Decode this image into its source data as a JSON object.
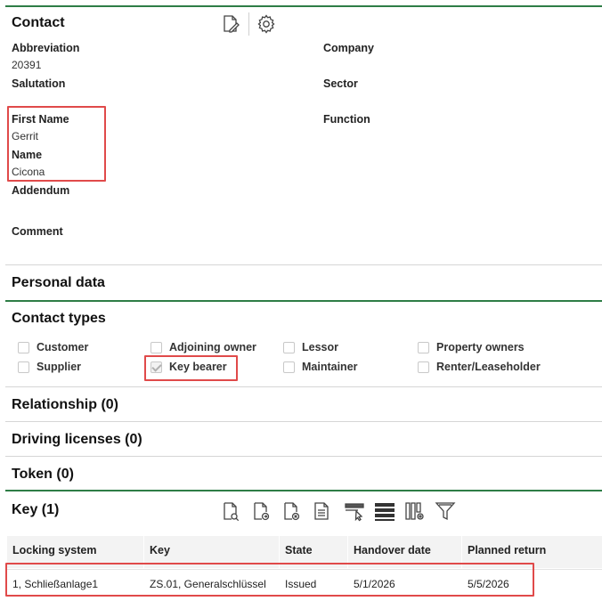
{
  "contact": {
    "title": "Contact",
    "fields": {
      "abbreviation_label": "Abbreviation",
      "abbreviation_value": "20391",
      "salutation_label": "Salutation",
      "first_name_label": "First Name",
      "first_name_value": "Gerrit",
      "name_label": "Name",
      "name_value": "Cicona",
      "addendum_label": "Addendum",
      "comment_label": "Comment",
      "company_label": "Company",
      "sector_label": "Sector",
      "function_label": "Function"
    },
    "icons": [
      "edit-document-icon",
      "gear-icon"
    ]
  },
  "personal_data": {
    "title": "Personal data"
  },
  "contact_types": {
    "title": "Contact types",
    "options": [
      {
        "label": "Customer",
        "checked": false
      },
      {
        "label": "Adjoining owner",
        "checked": false
      },
      {
        "label": "Lessor",
        "checked": false
      },
      {
        "label": "Property owners",
        "checked": false
      },
      {
        "label": "Supplier",
        "checked": false
      },
      {
        "label": "Key bearer",
        "checked": true
      },
      {
        "label": "Maintainer",
        "checked": false
      },
      {
        "label": "Renter/Leaseholder",
        "checked": false
      }
    ]
  },
  "relationship": {
    "title": "Relationship (0)"
  },
  "driving_licenses": {
    "title": "Driving licenses (0)"
  },
  "token": {
    "title": "Token (0)"
  },
  "key": {
    "title": "Key (1)",
    "toolbar_icons": [
      "search-document-icon",
      "document-forward-icon",
      "document-cancel-icon",
      "document-list-icon",
      "select-cursor-icon",
      "rows-icon",
      "columns-settings-icon",
      "filter-icon"
    ],
    "columns": [
      "Locking system",
      "Key",
      "State",
      "Handover date",
      "Planned return"
    ],
    "rows": [
      [
        "1, Schließanlage1",
        "ZS.01, Generalschlüssel",
        "Issued",
        "5/1/2026",
        "5/5/2026"
      ]
    ]
  },
  "colors": {
    "accent_line": "#2e7d46",
    "highlight_box": "#e04a4a"
  }
}
